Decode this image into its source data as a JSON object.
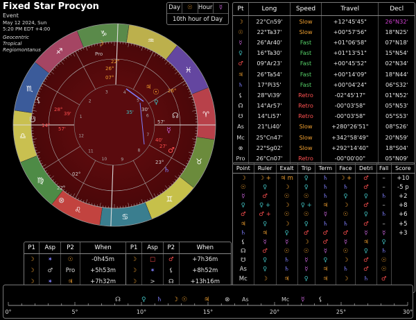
{
  "header": {
    "title": "Fixed Star Procyon",
    "subtitle": "Event",
    "date": "May 12 2024, Sun",
    "time": "5:20 PM EDT +4:00",
    "zodiac": "Geocentric",
    "zodiac_type": "Tropical",
    "house_system": "Regiomontanus"
  },
  "day_hour": {
    "day_label": "Day",
    "day_ruler_glyph": "☉",
    "hour_label": "Hour",
    "hour_ruler_glyph": "☿",
    "planetary_hour": "10th hour of Day"
  },
  "positions": {
    "headers": [
      "Pt",
      "Long",
      "Speed",
      "Travel",
      "Decl"
    ],
    "rows": [
      {
        "pt": "☽",
        "long": "22°Cn59'",
        "speed": "Slow",
        "travel": "+12°45'45\"",
        "decl": "26°N32'"
      },
      {
        "pt": "☉",
        "long": "22°Ta37'",
        "speed": "Slow",
        "travel": "+00°57'56\"",
        "decl": "18°N25'"
      },
      {
        "pt": "☿",
        "long": "26°Ar40'",
        "speed": "Fast",
        "travel": "+01°06'58\"",
        "decl": "07°N18'"
      },
      {
        "pt": "♀",
        "long": "16°Ta30'",
        "speed": "Fast",
        "travel": "+01°13'51\"",
        "decl": "15°N54'"
      },
      {
        "pt": "♂",
        "long": "09°Ar23'",
        "speed": "Fast",
        "travel": "+00°45'52\"",
        "decl": "02°N34'"
      },
      {
        "pt": "♃",
        "long": "26°Ta54'",
        "speed": "Fast",
        "travel": "+00°14'09\"",
        "decl": "18°N44'"
      },
      {
        "pt": "♄",
        "long": "17°Pi35'",
        "speed": "Fast",
        "travel": "+00°04'24\"",
        "decl": "06°S32'"
      },
      {
        "pt": "⚸",
        "long": "28°Vi39'",
        "speed": "Retro",
        "travel": "-02°45'17\"",
        "decl": "01°N52'"
      },
      {
        "pt": "☊",
        "long": "14°Ar57'",
        "speed": "Retro",
        "travel": "-00°03'58\"",
        "decl": "05°N53'"
      },
      {
        "pt": "☋",
        "long": "14°Li57'",
        "speed": "Retro",
        "travel": "-00°03'58\"",
        "decl": "05°S53'"
      },
      {
        "pt": "As",
        "long": "21°Li40'",
        "speed": "Slow",
        "travel": "+280°26'51\"",
        "decl": "08°S26'"
      },
      {
        "pt": "Mc",
        "long": "25°Cn47'",
        "speed": "Slow",
        "travel": "+342°58'49\"",
        "decl": "20°N59'"
      },
      {
        "pt": "⊗",
        "long": "22°Sg02'",
        "speed": "Slow",
        "travel": "+292°14'40\"",
        "decl": "18°S04'"
      },
      {
        "pt": "Pro",
        "long": "26°Cn07'",
        "speed": "Retro",
        "travel": "-00°00'00\"",
        "decl": "05°N09'"
      }
    ]
  },
  "dignities": {
    "headers": [
      "Point",
      "Ruler",
      "Exalt",
      "Trip",
      "Term",
      "Face",
      "Detri",
      "Fall",
      "Score"
    ],
    "rows": [
      {
        "point": "☽",
        "ruler": "☽ +",
        "exalt": "♃ m",
        "trip": "♀",
        "term": "♄",
        "face": "☽ +",
        "detri": "♂",
        "fall": "–",
        "score": "+10"
      },
      {
        "point": "☉",
        "ruler": "♀",
        "exalt": "☽",
        "trip": "♀",
        "term": "♄",
        "face": "♄",
        "detri": "♂",
        "fall": "–",
        "score": "-5 p"
      },
      {
        "point": "☿",
        "ruler": "♂",
        "exalt": "☉",
        "trip": "☉",
        "term": "♄",
        "face": "♀",
        "detri": "♀",
        "fall": "♄",
        "score": "+2"
      },
      {
        "point": "♀",
        "ruler": "♀ +",
        "exalt": "☽",
        "trip": "♀ +",
        "term": "♃",
        "face": "☽",
        "detri": "♂",
        "fall": "–",
        "score": "+8"
      },
      {
        "point": "♂",
        "ruler": "♂ +",
        "exalt": "☉",
        "trip": "☉",
        "term": "☿",
        "face": "☉",
        "detri": "♀",
        "fall": "♄",
        "score": "+6"
      },
      {
        "point": "♃",
        "ruler": "♀",
        "exalt": "☽",
        "trip": "♀",
        "term": "♄",
        "face": "♄",
        "detri": "♂",
        "fall": "–",
        "score": "+5"
      },
      {
        "point": "♄",
        "ruler": "♃",
        "exalt": "♀",
        "trip": "♂",
        "term": "♂",
        "face": "♂",
        "detri": "☿",
        "fall": "☿",
        "score": "+3"
      },
      {
        "point": "⚸",
        "ruler": "☿",
        "exalt": "☿",
        "trip": "☽",
        "term": "♂",
        "face": "☿",
        "detri": "♃",
        "fall": "♀",
        "score": ""
      },
      {
        "point": "☊",
        "ruler": "♂",
        "exalt": "☉",
        "trip": "☉",
        "term": "☿",
        "face": "☉",
        "detri": "♀",
        "fall": "♄",
        "score": ""
      },
      {
        "point": "☋",
        "ruler": "♀",
        "exalt": "♄",
        "trip": "☿",
        "term": "♀",
        "face": "☽",
        "detri": "♂",
        "fall": "☉",
        "score": ""
      },
      {
        "point": "As",
        "ruler": "♀",
        "exalt": "♄",
        "trip": "☿",
        "term": "♃",
        "face": "♄",
        "detri": "♂",
        "fall": "☉",
        "score": ""
      },
      {
        "point": "Mc",
        "ruler": "☽",
        "exalt": "♃",
        "trip": "♀",
        "term": "♃",
        "face": "☽",
        "detri": "♄",
        "fall": "♂",
        "score": ""
      },
      {
        "point": "⊗",
        "ruler": "♃",
        "exalt": "☋",
        "trip": "♂",
        "term": "♄",
        "face": "☽",
        "detri": "☿",
        "fall": "☊",
        "score": ""
      }
    ]
  },
  "aspects": {
    "headers": [
      "P1",
      "Asp",
      "P2",
      "When",
      "P1",
      "Asp",
      "P2",
      "When"
    ],
    "rows": [
      [
        "☽",
        "✶",
        "☉",
        "-0h45m",
        "☽",
        "□",
        "♂",
        "+7h36m"
      ],
      [
        "☽",
        "♂",
        "Pro",
        "+5h53m",
        "☽",
        "✶",
        "⚸",
        "+8h52m"
      ],
      [
        "☽",
        "✶",
        "♃",
        "+7h32m",
        "☽",
        ">",
        "☊",
        "+13h16m"
      ]
    ]
  },
  "timeline": {
    "ticks": [
      "0°",
      "5°",
      "10°",
      "15°",
      "20°",
      "25°",
      "30°"
    ]
  },
  "wheel": {
    "signs": [
      "♈",
      "♉",
      "♊",
      "♋",
      "♌",
      "♍",
      "♎",
      "♏",
      "♐",
      "♑",
      "♒",
      "♓"
    ],
    "house_numbers": [
      "1",
      "2",
      "3",
      "4",
      "5",
      "6",
      "7",
      "8",
      "9",
      "10",
      "11",
      "12"
    ],
    "labels": [
      {
        "text": "22°",
        "name": "mc-degree"
      },
      {
        "text": "Pro",
        "name": "procyon-label"
      },
      {
        "text": "26°",
        "name": "moon-degree"
      },
      {
        "text": "07°",
        "name": "mc-minute"
      },
      {
        "text": "28°",
        "name": "lilith-degree"
      },
      {
        "text": "39'",
        "name": "lilith-minute"
      },
      {
        "text": "14°",
        "name": "node-degree"
      },
      {
        "text": "57'",
        "name": "node-minute"
      },
      {
        "text": "02°",
        "name": "pof-minute"
      },
      {
        "text": "22°",
        "name": "pof-degree"
      },
      {
        "text": "26°",
        "name": "jupiter-degree"
      },
      {
        "text": "35'",
        "name": "venus-minute"
      },
      {
        "text": "30'",
        "name": "sun-minute"
      },
      {
        "text": "23°",
        "name": "sun-degree2"
      },
      {
        "text": "40'",
        "name": "mercury-minute"
      },
      {
        "text": "57'",
        "name": "node2-minute"
      },
      {
        "text": "27'",
        "name": "mars-minute"
      }
    ]
  },
  "colors": {
    "slow": "#f0a030",
    "fast": "#56d068",
    "retro": "#ff5050",
    "chart_bg": "#5a0b0e",
    "moon": "#f0a030",
    "sun": "#f0a030",
    "mercury": "#c060d0",
    "venus": "#40c0c0",
    "mars": "#ff5050"
  }
}
